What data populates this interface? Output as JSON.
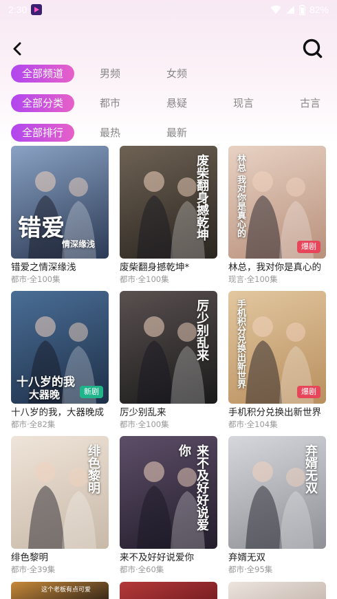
{
  "status_bar": {
    "time": "2:30",
    "battery": "82%"
  },
  "filters": {
    "channel": [
      "全部频道",
      "男频",
      "女频"
    ],
    "category": [
      "全部分类",
      "都市",
      "悬疑",
      "现言",
      "古言"
    ],
    "ranking": [
      "全部排行",
      "最热",
      "最新"
    ]
  },
  "dramas": [
    {
      "title": "错爱之情深缘浅",
      "meta": "都市·全100集",
      "badge": "",
      "poster_title": "错爱",
      "poster_sub": "情深缘浅",
      "colors": [
        "#2b3a55",
        "#8aa2c4"
      ]
    },
    {
      "title": "废柴翻身撼乾坤*",
      "meta": "都市·全100集",
      "badge": "",
      "poster_title": "废柴翻身撼乾坤",
      "poster_sub": "",
      "colors": [
        "#2a2520",
        "#6e6254"
      ]
    },
    {
      "title": "林总，我对你是真心的",
      "meta": "现言·全100集",
      "badge": "爆剧",
      "poster_title": "林总 我对你是真心的",
      "poster_sub": "",
      "colors": [
        "#b8907c",
        "#e8d2c4"
      ]
    },
    {
      "title": "十八岁的我，大器晚成",
      "meta": "都市·全82集",
      "badge": "新剧",
      "poster_title": "十八岁的我",
      "poster_sub": "大器晚",
      "colors": [
        "#1e2f48",
        "#4a6e96"
      ]
    },
    {
      "title": "厉少别乱来",
      "meta": "都市·全100集",
      "badge": "",
      "poster_title": "厉少别乱来",
      "poster_sub": "",
      "colors": [
        "#1a1a1a",
        "#5a5050"
      ]
    },
    {
      "title": "手机积分兑换出新世界",
      "meta": "都市·全104集",
      "badge": "爆剧",
      "poster_title": "手机积分兑换出新世界",
      "poster_sub": "",
      "colors": [
        "#b98f5e",
        "#e2c7a0"
      ]
    },
    {
      "title": "绯色黎明",
      "meta": "都市·全39集",
      "badge": "",
      "poster_title": "绯色黎明",
      "poster_sub": "",
      "colors": [
        "#c8b9a8",
        "#efe4d9"
      ]
    },
    {
      "title": "来不及好好说爱你",
      "meta": "都市·全60集",
      "badge": "",
      "poster_title": "来不及好好说爱你",
      "poster_sub": "",
      "colors": [
        "#231d2b",
        "#5d4e68"
      ]
    },
    {
      "title": "弃婿无双",
      "meta": "都市·全95集",
      "badge": "",
      "poster_title": "弃婿无双",
      "poster_sub": "",
      "colors": [
        "#8e9096",
        "#d6d7dc"
      ]
    }
  ],
  "partial_posters": [
    {
      "caption": "这个老板有点可爱",
      "colors": [
        "#3a2a1a",
        "#c88a3a"
      ]
    },
    {
      "caption": "",
      "colors": [
        "#7a1e22",
        "#b43a3a"
      ]
    },
    {
      "caption": "",
      "colors": [
        "#c9bcb4",
        "#ece4de"
      ]
    }
  ]
}
